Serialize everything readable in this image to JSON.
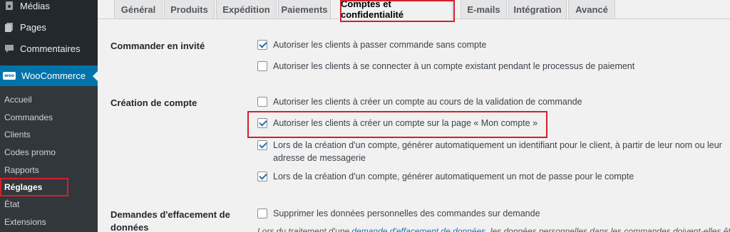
{
  "sidebar": {
    "top_items": [
      {
        "label": "Médias",
        "icon": "media-icon"
      },
      {
        "label": "Pages",
        "icon": "pages-icon"
      },
      {
        "label": "Commentaires",
        "icon": "comments-icon"
      }
    ],
    "woocommerce": {
      "label": "WooCommerce",
      "badge": "woo"
    },
    "sub_items": [
      "Accueil",
      "Commandes",
      "Clients",
      "Codes promo",
      "Rapports",
      "Réglages",
      "État",
      "Extensions"
    ],
    "active_sub": "Réglages"
  },
  "tabs": [
    "Général",
    "Produits",
    "Expédition",
    "Paiements",
    "Comptes et confidentialité",
    "E-mails",
    "Intégration",
    "Avancé"
  ],
  "active_tab": "Comptes et confidentialité",
  "sections": {
    "guest": {
      "label": "Commander en invité",
      "options": [
        {
          "text": "Autoriser les clients à passer commande sans compte",
          "checked": true
        },
        {
          "text": "Autoriser les clients à se connecter à un compte existant pendant le processus de paiement",
          "checked": false
        }
      ]
    },
    "account_creation": {
      "label": "Création de compte",
      "options": [
        {
          "text": "Autoriser les clients à créer un compte au cours de la validation de commande",
          "checked": false
        },
        {
          "text": "Autoriser les clients à créer un compte sur la page « Mon compte »",
          "checked": true
        },
        {
          "text": "Lors de la création d'un compte, générer automatiquement un identifiant pour le client, à partir de leur nom ou leur adresse de messagerie",
          "checked": true
        },
        {
          "text": "Lors de la création d'un compte, générer automatiquement un mot de passe pour le compte",
          "checked": true
        }
      ]
    },
    "erasure": {
      "label": "Demandes d'effacement de données",
      "options": [
        {
          "text": "Supprimer les données personnelles des commandes sur demande",
          "checked": false
        }
      ],
      "description_prefix": "Lors du traitement d'une ",
      "description_link": "demande d'effacement de données",
      "description_suffix": ", les données personnelles dans les commandes doivent-elles être ret"
    }
  },
  "colors": {
    "highlight": "#d4202a",
    "accent": "#0073aa",
    "sidebar": "#23282d"
  }
}
